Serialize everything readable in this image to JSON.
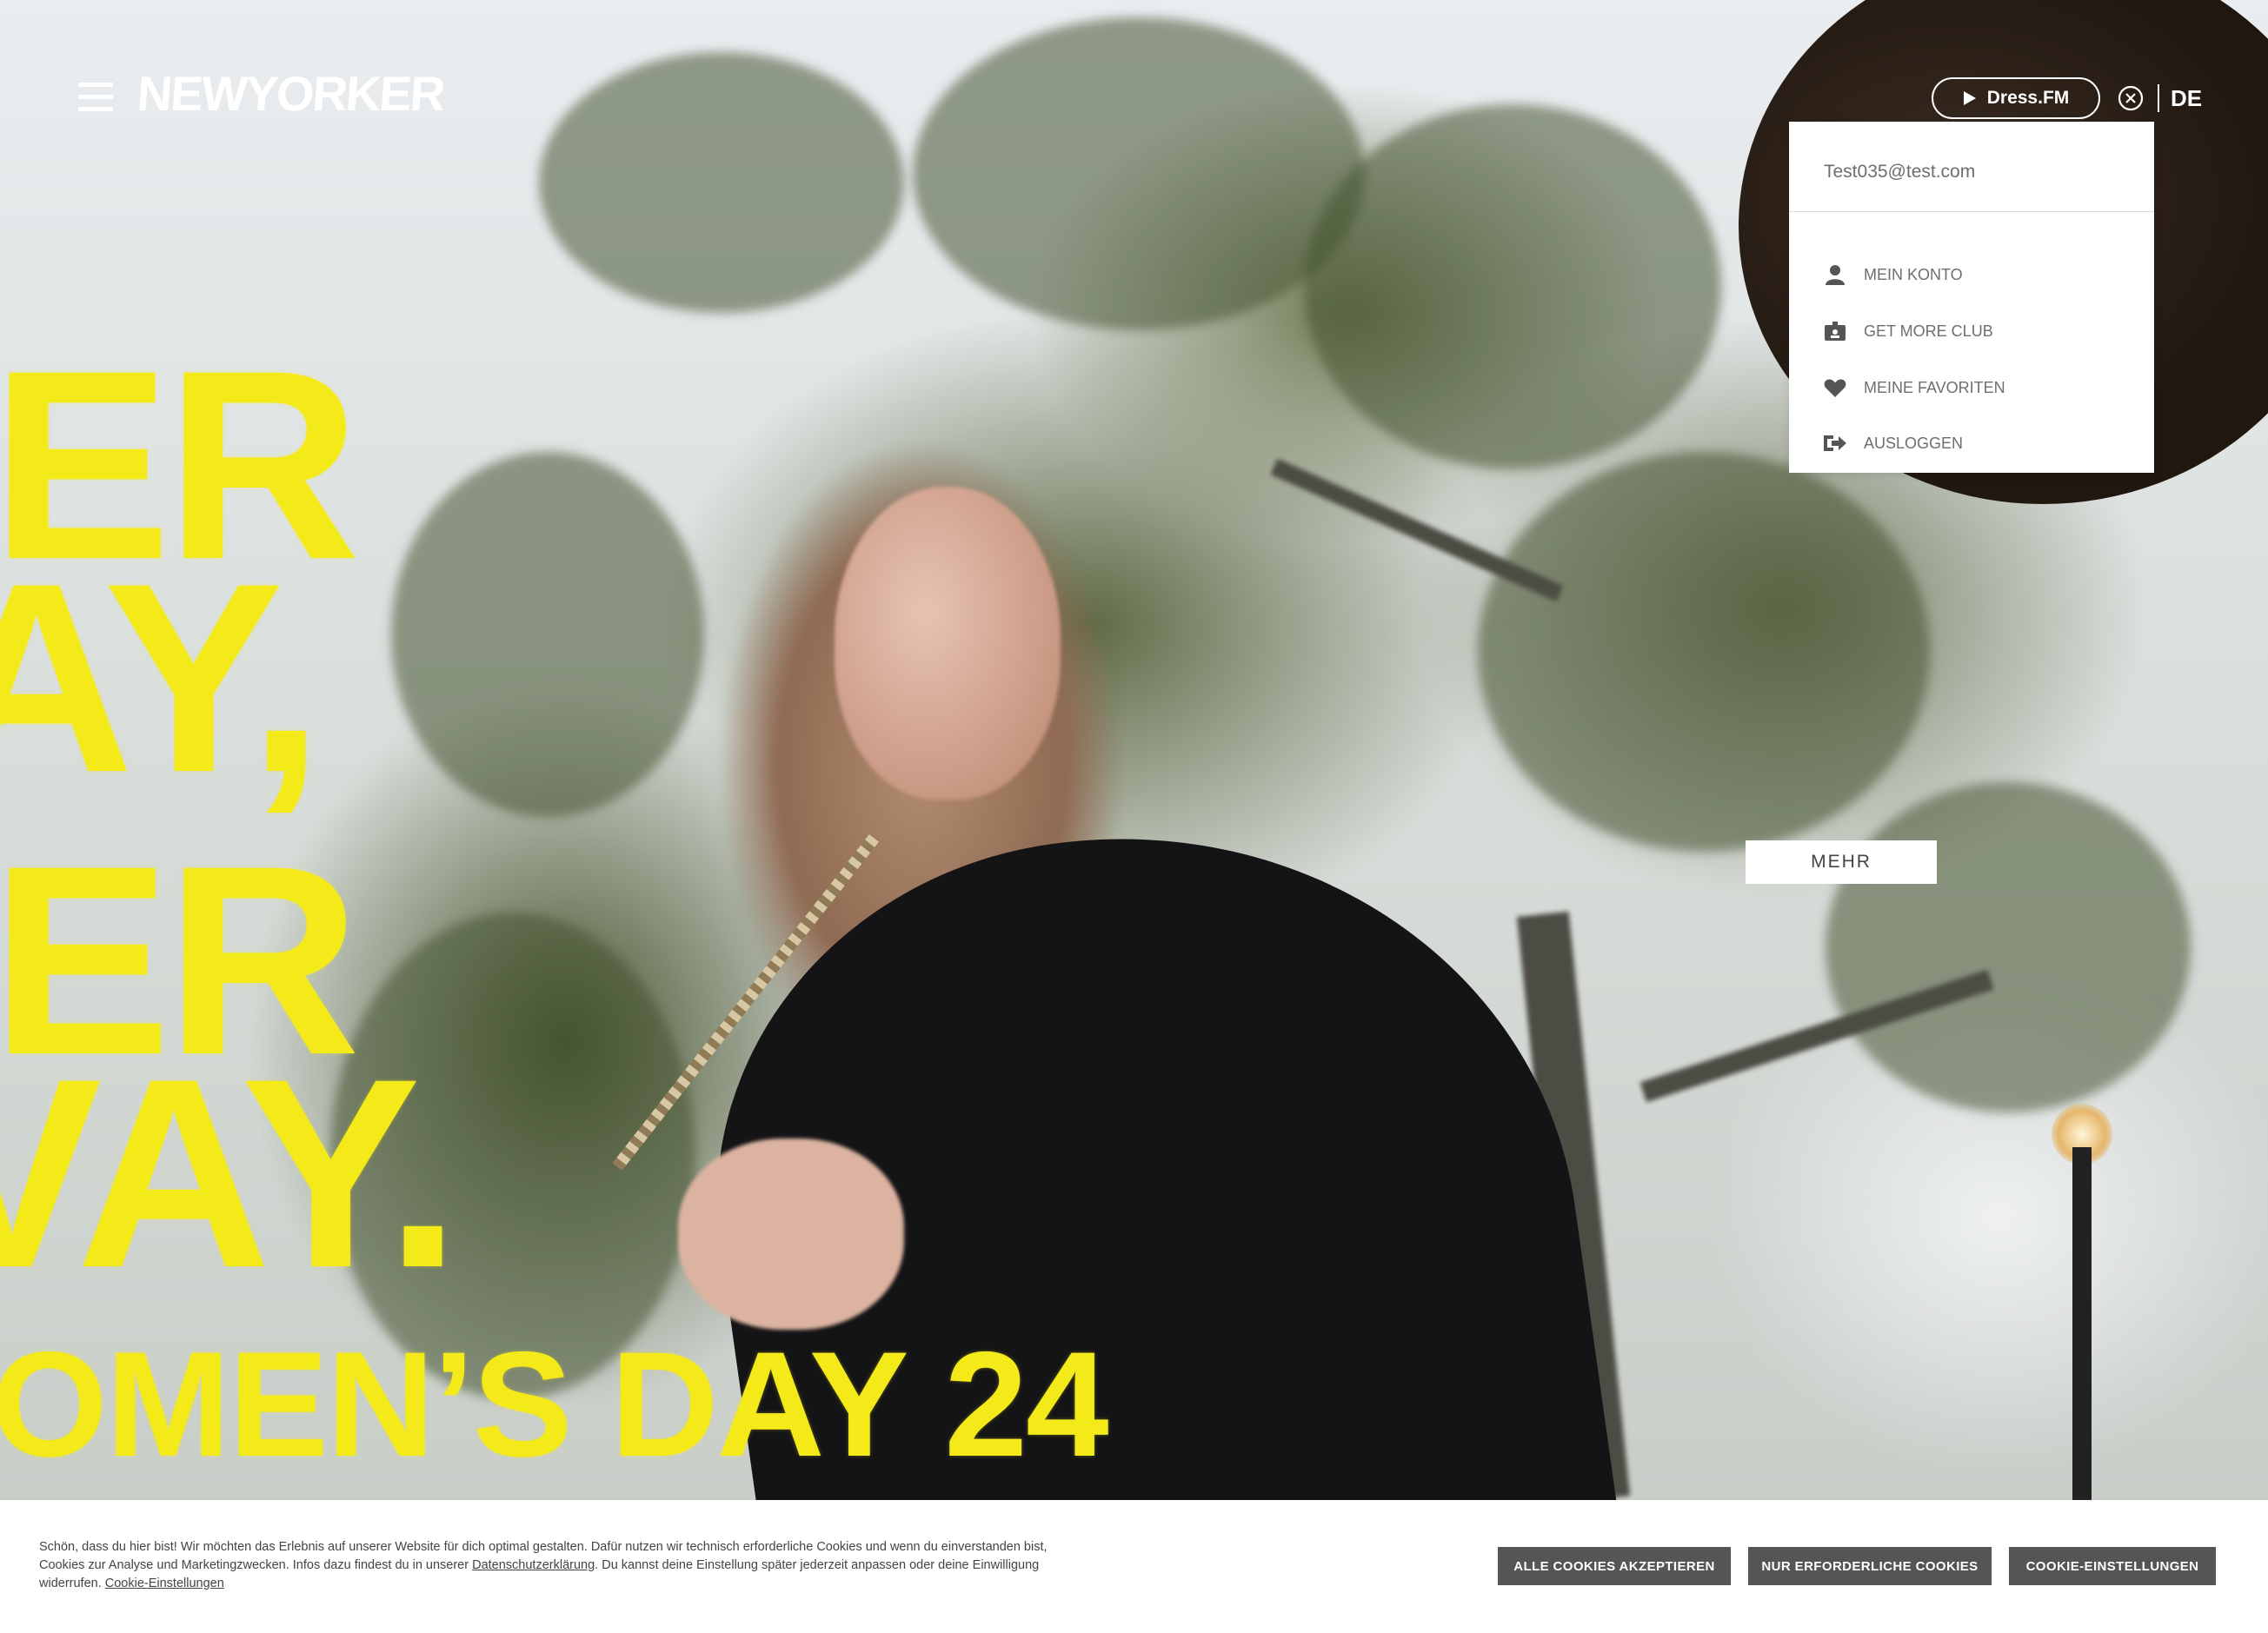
{
  "header": {
    "logo_text": "NEWYORKER",
    "dress_fm_label": "Dress.FM",
    "language": "DE"
  },
  "hero": {
    "slogan_lines": [
      "ER",
      "AY,",
      "ER",
      "VAY.",
      "OMEN’S DAY 24"
    ],
    "more_button_label": "MEHR"
  },
  "account_menu": {
    "email": "Test035@test.com",
    "items": [
      {
        "label": "MEIN KONTO",
        "icon": "user-icon"
      },
      {
        "label": "GET MORE CLUB",
        "icon": "member-card-icon"
      },
      {
        "label": "MEINE FAVORITEN",
        "icon": "heart-icon"
      },
      {
        "label": "AUSLOGGEN",
        "icon": "logout-icon"
      }
    ]
  },
  "cookie_banner": {
    "text_part1": "Schön, dass du hier bist! Wir möchten das Erlebnis auf unserer Website für dich optimal gestalten. Dafür nutzen wir technisch erforderliche Cookies und wenn du einverstanden bist, Cookies zur Analyse und Marketingzwecken. Infos dazu findest du in unserer ",
    "privacy_link": "Datenschutzerklärung",
    "text_part2": ". Du kannst deine Einstellung später jederzeit anpassen oder deine Einwilligung widerrufen. ",
    "settings_link": "Cookie-Einstellungen",
    "accept_all_label": "ALLE COOKIES AKZEPTIEREN",
    "necessary_only_label": "NUR ERFORDERLICHE COOKIES",
    "settings_button_label": "COOKIE-EINSTELLUNGEN"
  },
  "colors": {
    "slogan_yellow": "#f4ea1a",
    "cookie_button_bg": "#555555"
  }
}
